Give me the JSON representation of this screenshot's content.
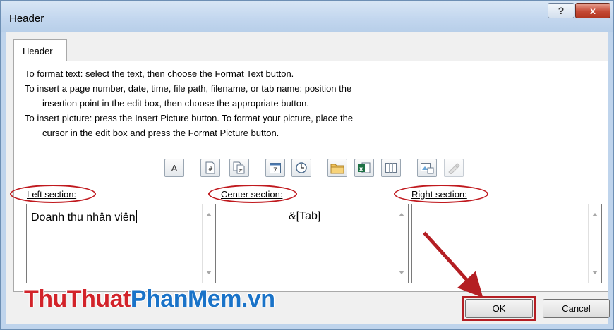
{
  "window": {
    "title": "Header",
    "help_label": "?",
    "close_label": "x"
  },
  "tab": {
    "label": "Header"
  },
  "instructions": [
    "To format text:  select the text, then choose the Format Text button.",
    "To insert a page number, date, time, file path, filename, or tab name:  position the",
    "insertion point in the edit box, then choose the appropriate button.",
    "To insert picture: press the Insert Picture button.  To format your picture, place the",
    "cursor in the edit box and press the Format Picture button."
  ],
  "toolbar": {
    "format_text_glyph": "A",
    "icons": [
      "format-text-icon",
      "page-number-icon",
      "number-of-pages-icon",
      "date-icon",
      "time-icon",
      "file-path-icon",
      "filename-icon",
      "sheet-name-icon",
      "insert-picture-icon",
      "format-picture-icon"
    ]
  },
  "sections": {
    "left": {
      "label": "Left section:",
      "value": "Doanh thu nhân viên"
    },
    "center": {
      "label": "Center section:",
      "value": "&[Tab]"
    },
    "right": {
      "label": "Right section:",
      "value": ""
    }
  },
  "buttons": {
    "ok": "OK",
    "cancel": "Cancel"
  },
  "watermark": {
    "part1": "ThuThuat",
    "part2": "PhanMem",
    "part3": ".vn"
  },
  "colors": {
    "annotation_red": "#c0191e",
    "watermark_red": "#d2232a",
    "watermark_blue": "#1a73c8"
  }
}
